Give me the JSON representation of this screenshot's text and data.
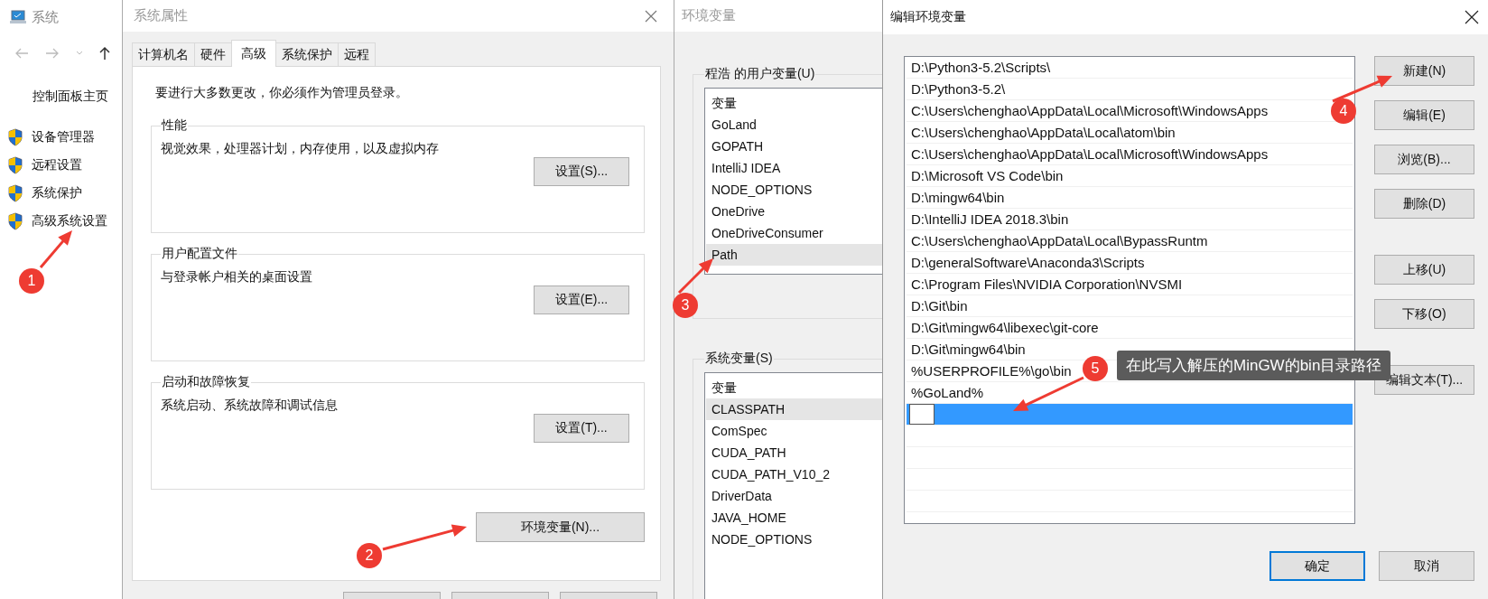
{
  "system_window": {
    "title": "系统",
    "nav_link": "控制面板主页",
    "tasks": [
      "设备管理器",
      "远程设置",
      "系统保护",
      "高级系统设置"
    ]
  },
  "system_properties": {
    "title": "系统属性",
    "tabs": [
      {
        "label": "计算机名",
        "selected": false
      },
      {
        "label": "硬件",
        "selected": false
      },
      {
        "label": "高级",
        "selected": true
      },
      {
        "label": "系统保护",
        "selected": false
      },
      {
        "label": "远程",
        "selected": false
      }
    ],
    "admin_note": "要进行大多数更改，你必须作为管理员登录。",
    "groups": [
      {
        "title": "性能",
        "description": "视觉效果，处理器计划，内存使用，以及虚拟内存",
        "button": "设置(S)..."
      },
      {
        "title": "用户配置文件",
        "description": "与登录帐户相关的桌面设置",
        "button": "设置(E)..."
      },
      {
        "title": "启动和故障恢复",
        "description": "系统启动、系统故障和调试信息",
        "button": "设置(T)..."
      }
    ],
    "env_button": "环境变量(N)..."
  },
  "environment_variables": {
    "title": "环境变量",
    "user_group": {
      "title": "程浩 的用户变量(U)",
      "header": "变量",
      "rows": [
        {
          "name": "GoLand",
          "selected": false
        },
        {
          "name": "GOPATH",
          "selected": false
        },
        {
          "name": "IntelliJ IDEA",
          "selected": false
        },
        {
          "name": "NODE_OPTIONS",
          "selected": false
        },
        {
          "name": "OneDrive",
          "selected": false
        },
        {
          "name": "OneDriveConsumer",
          "selected": false
        },
        {
          "name": "Path",
          "selected": true
        }
      ]
    },
    "system_group": {
      "title": "系统变量(S)",
      "header": "变量",
      "rows": [
        {
          "name": "CLASSPATH",
          "selected": true
        },
        {
          "name": "ComSpec",
          "selected": false
        },
        {
          "name": "CUDA_PATH",
          "selected": false
        },
        {
          "name": "CUDA_PATH_V10_2",
          "selected": false
        },
        {
          "name": "DriverData",
          "selected": false
        },
        {
          "name": "JAVA_HOME",
          "selected": false
        },
        {
          "name": "NODE_OPTIONS",
          "selected": false
        }
      ]
    }
  },
  "edit_dialog": {
    "title": "编辑环境变量",
    "entries": [
      {
        "kind": "text",
        "text": "D:\\Python3-5.2\\Scripts\\",
        "selected": false
      },
      {
        "kind": "text",
        "text": "D:\\Python3-5.2\\",
        "selected": false
      },
      {
        "kind": "text",
        "text": "C:\\Users\\chenghao\\AppData\\Local\\Microsoft\\WindowsApps",
        "selected": false
      },
      {
        "kind": "text",
        "text": "C:\\Users\\chenghao\\AppData\\Local\\atom\\bin",
        "selected": false
      },
      {
        "kind": "text",
        "text": "C:\\Users\\chenghao\\AppData\\Local\\Microsoft\\WindowsApps",
        "selected": false
      },
      {
        "kind": "text",
        "text": "D:\\Microsoft VS Code\\bin",
        "selected": false
      },
      {
        "kind": "text",
        "text": "D:\\mingw64\\bin",
        "selected": false
      },
      {
        "kind": "text",
        "text": "D:\\IntelliJ IDEA 2018.3\\bin",
        "selected": false
      },
      {
        "kind": "text",
        "text": "C:\\Users\\chenghao\\AppData\\Local\\BypassRuntm",
        "selected": false
      },
      {
        "kind": "text",
        "text": "D:\\generalSoftware\\Anaconda3\\Scripts",
        "selected": false
      },
      {
        "kind": "text",
        "text": "C:\\Program Files\\NVIDIA Corporation\\NVSMI",
        "selected": false
      },
      {
        "kind": "text",
        "text": "D:\\Git\\bin",
        "selected": false
      },
      {
        "kind": "text",
        "text": "D:\\Git\\mingw64\\libexec\\git-core",
        "selected": false
      },
      {
        "kind": "text",
        "text": "D:\\Git\\mingw64\\bin",
        "selected": false
      },
      {
        "kind": "text",
        "text": "%USERPROFILE%\\go\\bin",
        "selected": false
      },
      {
        "kind": "text",
        "text": "%GoLand%",
        "selected": false
      },
      {
        "kind": "edit",
        "selected": true
      }
    ],
    "buttons": [
      "新建(N)",
      "编辑(E)",
      "浏览(B)...",
      "删除(D)",
      "上移(U)",
      "下移(O)",
      "编辑文本(T)..."
    ],
    "ok": "确定",
    "cancel": "取消"
  },
  "annotations": [
    {
      "number": "1"
    },
    {
      "number": "2"
    },
    {
      "number": "3"
    },
    {
      "number": "4"
    },
    {
      "number": "5"
    }
  ],
  "callout": "在此写入解压的MinGW的bin目录路径"
}
